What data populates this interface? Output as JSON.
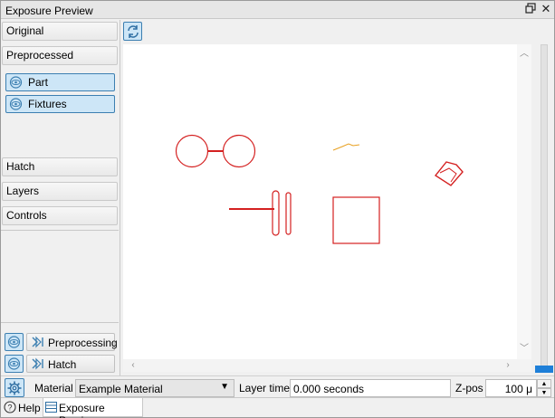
{
  "window": {
    "title": "Exposure Preview"
  },
  "titlebar_icons": {
    "float": "float-icon",
    "close": "close-icon"
  },
  "sidebar": {
    "original": "Original",
    "preprocessed": "Preprocessed",
    "sub_items": [
      {
        "label": "Part",
        "icon": "eye-icon"
      },
      {
        "label": "Fixtures",
        "icon": "eye-icon"
      }
    ],
    "hatch": "Hatch",
    "layers": "Layers",
    "controls": "Controls",
    "bottom": [
      {
        "label": "Preprocessing",
        "icon": "step-forward-icon"
      },
      {
        "label": "Hatch",
        "icon": "step-forward-icon"
      }
    ]
  },
  "toolbar": {
    "refresh_icon": "refresh-icon"
  },
  "colors": {
    "accent": "#1e7fd8",
    "geometry_red": "#d42020",
    "geometry_orange": "#e8a020",
    "selected_bg": "#cde6f7",
    "selected_border": "#3c7fb1"
  },
  "status": {
    "material_label": "Material",
    "material_value": "Example Material",
    "layer_time_label": "Layer time",
    "layer_time_value": "0.000 seconds",
    "zpos_label": "Z-pos",
    "zpos_value": "100 μ"
  },
  "tabs": [
    {
      "label": "Help",
      "icon": "help-icon"
    },
    {
      "label": "Exposure Preview",
      "icon": "list-icon"
    }
  ]
}
